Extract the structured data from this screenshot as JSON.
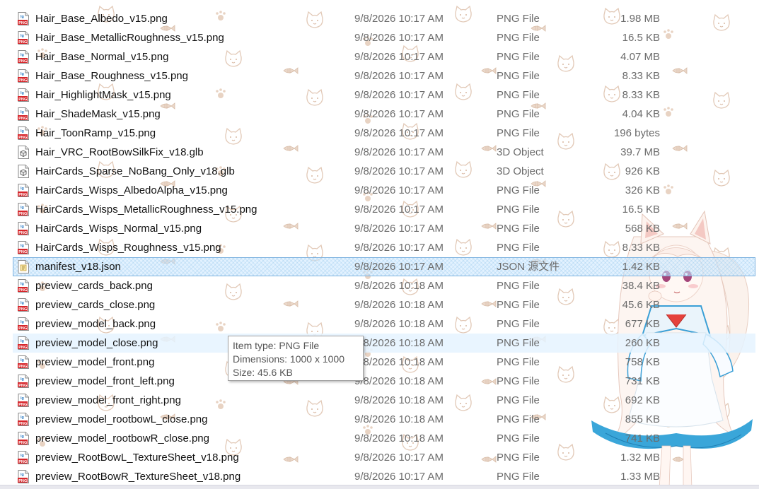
{
  "files": [
    {
      "name": "Hair_Base_Albedo_v15.png",
      "date": "9/8/2026 10:17 AM",
      "type": "PNG File",
      "size": "1.98 MB",
      "icon": "png-file-icon"
    },
    {
      "name": "Hair_Base_MetallicRoughness_v15.png",
      "date": "9/8/2026 10:17 AM",
      "type": "PNG File",
      "size": "16.5 KB",
      "icon": "png-file-icon"
    },
    {
      "name": "Hair_Base_Normal_v15.png",
      "date": "9/8/2026 10:17 AM",
      "type": "PNG File",
      "size": "4.07 MB",
      "icon": "png-file-icon"
    },
    {
      "name": "Hair_Base_Roughness_v15.png",
      "date": "9/8/2026 10:17 AM",
      "type": "PNG File",
      "size": "8.33 KB",
      "icon": "png-file-icon"
    },
    {
      "name": "Hair_HighlightMask_v15.png",
      "date": "9/8/2026 10:17 AM",
      "type": "PNG File",
      "size": "8.33 KB",
      "icon": "png-file-icon"
    },
    {
      "name": "Hair_ShadeMask_v15.png",
      "date": "9/8/2026 10:17 AM",
      "type": "PNG File",
      "size": "4.04 KB",
      "icon": "png-file-icon"
    },
    {
      "name": "Hair_ToonRamp_v15.png",
      "date": "9/8/2026 10:17 AM",
      "type": "PNG File",
      "size": "196 bytes",
      "icon": "png-file-icon"
    },
    {
      "name": "Hair_VRC_RootBowSilkFix_v18.glb",
      "date": "9/8/2026 10:17 AM",
      "type": "3D Object",
      "size": "39.7 MB",
      "icon": "3d-object-icon"
    },
    {
      "name": "HairCards_Sparse_NoBang_Only_v18.glb",
      "date": "9/8/2026 10:17 AM",
      "type": "3D Object",
      "size": "926 KB",
      "icon": "3d-object-icon"
    },
    {
      "name": "HairCards_Wisps_AlbedoAlpha_v15.png",
      "date": "9/8/2026 10:17 AM",
      "type": "PNG File",
      "size": "326 KB",
      "icon": "png-file-icon"
    },
    {
      "name": "HairCards_Wisps_MetallicRoughness_v15.png",
      "date": "9/8/2026 10:17 AM",
      "type": "PNG File",
      "size": "16.5 KB",
      "icon": "png-file-icon"
    },
    {
      "name": "HairCards_Wisps_Normal_v15.png",
      "date": "9/8/2026 10:17 AM",
      "type": "PNG File",
      "size": "568 KB",
      "icon": "png-file-icon"
    },
    {
      "name": "HairCards_Wisps_Roughness_v15.png",
      "date": "9/8/2026 10:17 AM",
      "type": "PNG File",
      "size": "8.33 KB",
      "icon": "png-file-icon"
    },
    {
      "name": "manifest_v18.json",
      "date": "9/8/2026 10:17 AM",
      "type": "JSON 源文件",
      "size": "1.42 KB",
      "icon": "json-file-icon",
      "state": "selected"
    },
    {
      "name": "preview_cards_back.png",
      "date": "9/8/2026 10:18 AM",
      "type": "PNG File",
      "size": "38.4 KB",
      "icon": "png-file-icon"
    },
    {
      "name": "preview_cards_close.png",
      "date": "9/8/2026 10:18 AM",
      "type": "PNG File",
      "size": "45.6 KB",
      "icon": "png-file-icon"
    },
    {
      "name": "preview_model_back.png",
      "date": "9/8/2026 10:18 AM",
      "type": "PNG File",
      "size": "677 KB",
      "icon": "png-file-icon"
    },
    {
      "name": "preview_model_close.png",
      "date": "9/8/2026 10:18 AM",
      "type": "PNG File",
      "size": "260 KB",
      "icon": "png-file-icon",
      "state": "hover"
    },
    {
      "name": "preview_model_front.png",
      "date": "9/8/2026 10:18 AM",
      "type": "PNG File",
      "size": "758 KB",
      "icon": "png-file-icon"
    },
    {
      "name": "preview_model_front_left.png",
      "date": "9/8/2026 10:18 AM",
      "type": "PNG File",
      "size": "731 KB",
      "icon": "png-file-icon"
    },
    {
      "name": "preview_model_front_right.png",
      "date": "9/8/2026 10:18 AM",
      "type": "PNG File",
      "size": "692 KB",
      "icon": "png-file-icon"
    },
    {
      "name": "preview_model_rootbowL_close.png",
      "date": "9/8/2026 10:18 AM",
      "type": "PNG File",
      "size": "855 KB",
      "icon": "png-file-icon"
    },
    {
      "name": "preview_model_rootbowR_close.png",
      "date": "9/8/2026 10:18 AM",
      "type": "PNG File",
      "size": "741 KB",
      "icon": "png-file-icon"
    },
    {
      "name": "preview_RootBowL_TextureSheet_v18.png",
      "date": "9/8/2026 10:17 AM",
      "type": "PNG File",
      "size": "1.32 MB",
      "icon": "png-file-icon"
    },
    {
      "name": "preview_RootBowR_TextureSheet_v18.png",
      "date": "9/8/2026 10:17 AM",
      "type": "PNG File",
      "size": "1.33 MB",
      "icon": "png-file-icon"
    }
  ],
  "tooltip": {
    "item_type": "Item type: PNG File",
    "dimensions": "Dimensions: 1000 x 1000",
    "size": "Size: 45.6 KB"
  },
  "colors": {
    "selection": "#cce8ff",
    "selection_border": "#7fb3e0",
    "hover": "#e5f3ff",
    "secondary_text": "#6b6b6b"
  }
}
